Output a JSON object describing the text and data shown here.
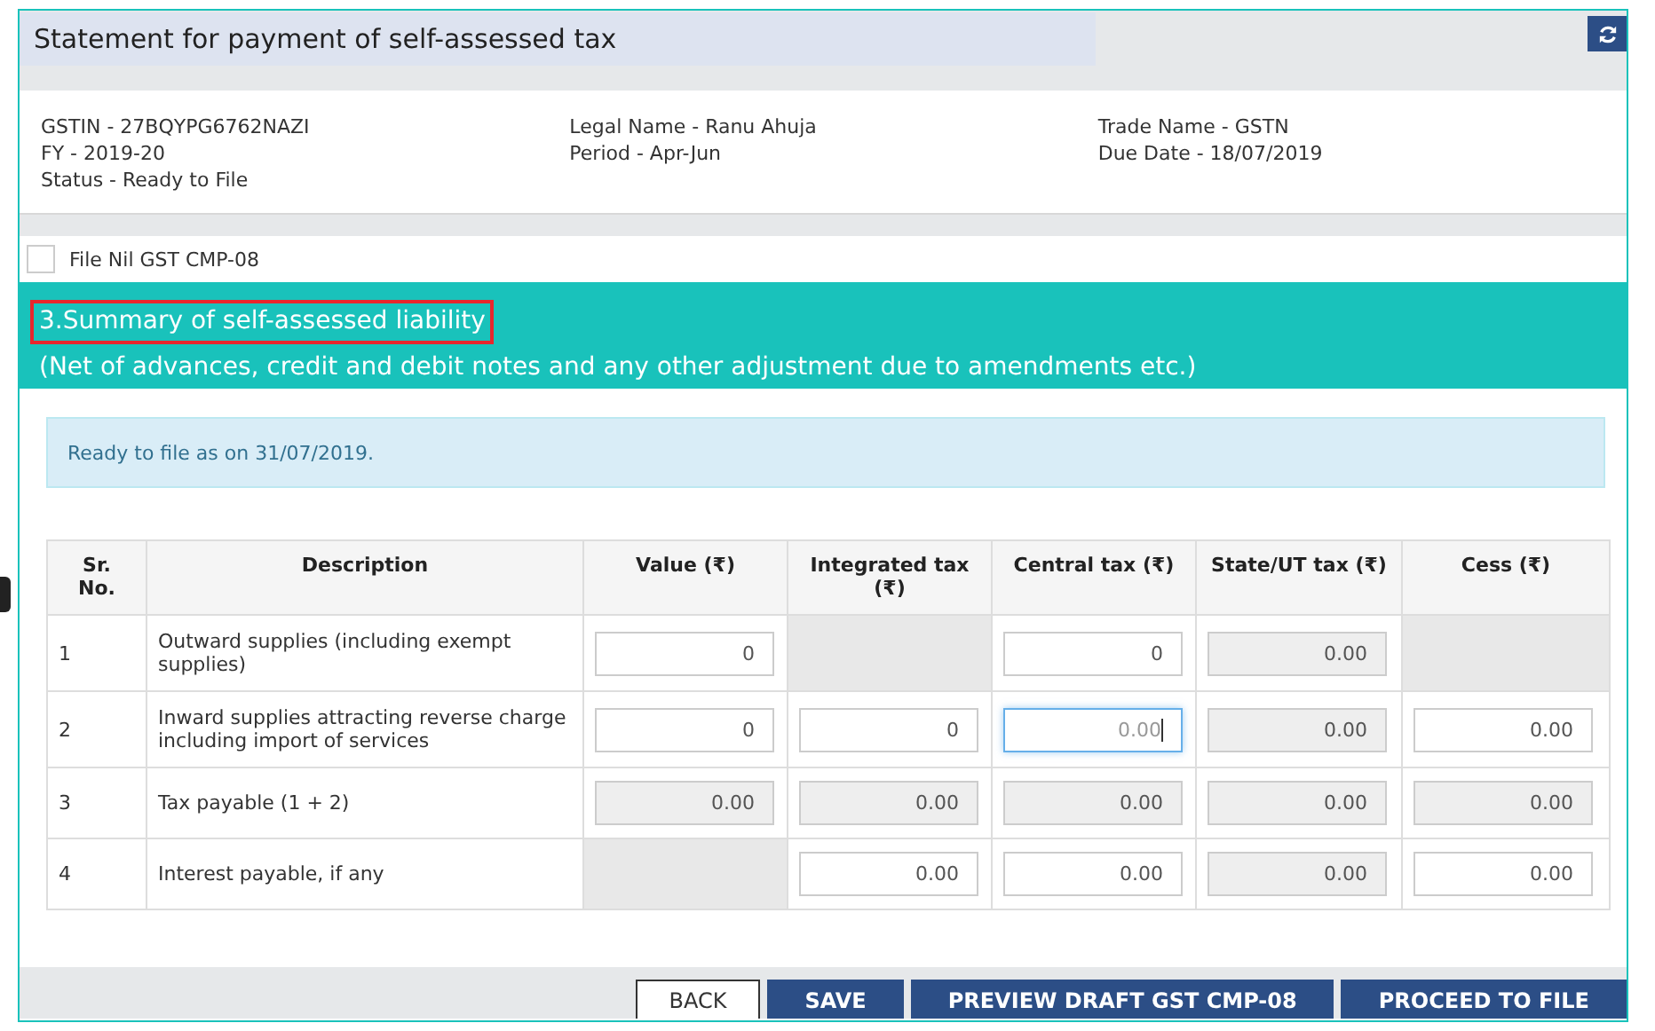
{
  "header": {
    "title": "Statement for payment of self-assessed tax"
  },
  "info": {
    "columns": [
      [
        "GSTIN - 27BQYPG6762NAZI",
        "FY - 2019-20",
        "Status - Ready to File"
      ],
      [
        "Legal Name - Ranu Ahuja",
        "Period - Apr-Jun"
      ],
      [
        "Trade Name - GSTN",
        "Due Date - 18/07/2019"
      ]
    ]
  },
  "nil_filing": {
    "label": "File Nil GST CMP-08",
    "checked": false
  },
  "section": {
    "title": "3.Summary of self-assessed liability",
    "subtitle": "(Net of advances, credit and debit notes and any other adjustment due to amendments etc.)",
    "title_highlighted": true
  },
  "alert": "Ready to file as on 31/07/2019.",
  "table": {
    "columns": [
      "Sr. No.",
      "Description",
      "Value (₹)",
      "Integrated tax (₹)",
      "Central tax (₹)",
      "State/UT tax (₹)",
      "Cess (₹)"
    ],
    "rows": [
      {
        "cells": [
          {
            "kind": "text",
            "value": "1"
          },
          {
            "kind": "text",
            "value": "Outward supplies (including exempt supplies)"
          },
          {
            "kind": "input",
            "value": "0"
          },
          {
            "kind": "blank"
          },
          {
            "kind": "input",
            "value": "0"
          },
          {
            "kind": "readonly",
            "value": "0.00"
          },
          {
            "kind": "blank"
          }
        ]
      },
      {
        "cells": [
          {
            "kind": "text",
            "value": "2"
          },
          {
            "kind": "text",
            "value": "Inward supplies attracting reverse charge including import of services"
          },
          {
            "kind": "input",
            "value": "0"
          },
          {
            "kind": "input",
            "value": "0"
          },
          {
            "kind": "input",
            "placeholder": "0.00",
            "focused": true
          },
          {
            "kind": "readonly",
            "value": "0.00"
          },
          {
            "kind": "input",
            "value": "0.00"
          }
        ]
      },
      {
        "cells": [
          {
            "kind": "text",
            "value": "3"
          },
          {
            "kind": "text",
            "value": "Tax payable (1 + 2)"
          },
          {
            "kind": "readonly",
            "value": "0.00"
          },
          {
            "kind": "readonly",
            "value": "0.00"
          },
          {
            "kind": "readonly",
            "value": "0.00"
          },
          {
            "kind": "readonly",
            "value": "0.00"
          },
          {
            "kind": "readonly",
            "value": "0.00"
          }
        ]
      },
      {
        "cells": [
          {
            "kind": "text",
            "value": "4"
          },
          {
            "kind": "text",
            "value": "Interest payable, if any"
          },
          {
            "kind": "blank"
          },
          {
            "kind": "input",
            "value": "0.00"
          },
          {
            "kind": "input",
            "value": "0.00"
          },
          {
            "kind": "readonly",
            "value": "0.00"
          },
          {
            "kind": "input",
            "value": "0.00"
          }
        ]
      }
    ]
  },
  "buttons": [
    {
      "label": "BACK",
      "kind": "secondary"
    },
    {
      "label": "SAVE",
      "kind": "primary"
    },
    {
      "label": "PREVIEW DRAFT GST CMP-08",
      "kind": "primary"
    },
    {
      "label": "PROCEED TO FILE",
      "kind": "primary"
    }
  ]
}
